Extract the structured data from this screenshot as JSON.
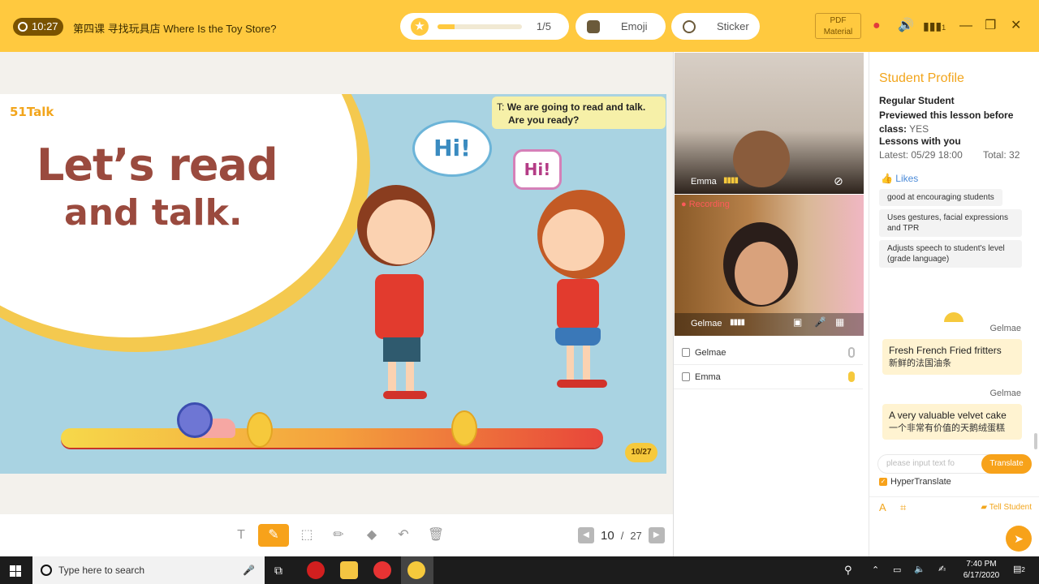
{
  "topbar": {
    "time": "10:27",
    "lesson_title": "第四课 寻找玩具店 Where Is the Toy Store?",
    "progress_text": "1/5",
    "progress_fraction": 0.2,
    "emoji_label": "Emoji",
    "sticker_label": "Sticker",
    "pdf_line1": "PDF",
    "pdf_line2": "Material",
    "signal_count": "1"
  },
  "slide": {
    "brand": "51Talk",
    "title_line1": "Let’s read",
    "title_line2": "and talk.",
    "teacher_prefix": "T:",
    "teacher_line1": "We are going to read and talk.",
    "teacher_line2": "Are you ready?",
    "bubble_boy": "Hi!",
    "bubble_girl": "Hi!",
    "page_badge": "10/27"
  },
  "toolbar": {
    "page_current": "10",
    "page_sep": "/",
    "page_total": "27"
  },
  "video": {
    "student_name": "Emma",
    "teacher_name": "Gelmae",
    "recording_label": "Recording"
  },
  "participants": [
    {
      "name": "Gelmae"
    },
    {
      "name": "Emma"
    }
  ],
  "profile": {
    "heading": "Student Profile",
    "regular": "Regular Student",
    "previewed_label": "Previewed this lesson before class:",
    "previewed_value": "YES",
    "lessons_label": "Lessons with you",
    "latest": "Latest: 05/29 18:00",
    "total": "Total: 32",
    "likes_label": "Likes",
    "tags": [
      "good at encouraging students",
      "Uses gestures, facial expressions and TPR",
      "Adjusts speech to student's level (grade language)"
    ]
  },
  "chat": [
    {
      "author": "Gelmae",
      "en": "Fresh French Fried fritters",
      "zh": "新鲜的法国油条"
    },
    {
      "author": "Gelmae",
      "en": "A very valuable velvet cake",
      "zh": "一个非常有价值的天鹅绒蛋糕"
    }
  ],
  "translate": {
    "placeholder": "please input text fo",
    "button": "Translate",
    "hyper_label": "HyperTranslate",
    "tell_student": "Tell Student"
  },
  "taskbar": {
    "search_placeholder": "Type here to search",
    "clock_time": "7:40 PM",
    "clock_date": "6/17/2020",
    "notif_count": "2"
  },
  "colors": {
    "accent": "#ffc93f",
    "button": "#f7a21a",
    "heading": "#f2a51c"
  }
}
